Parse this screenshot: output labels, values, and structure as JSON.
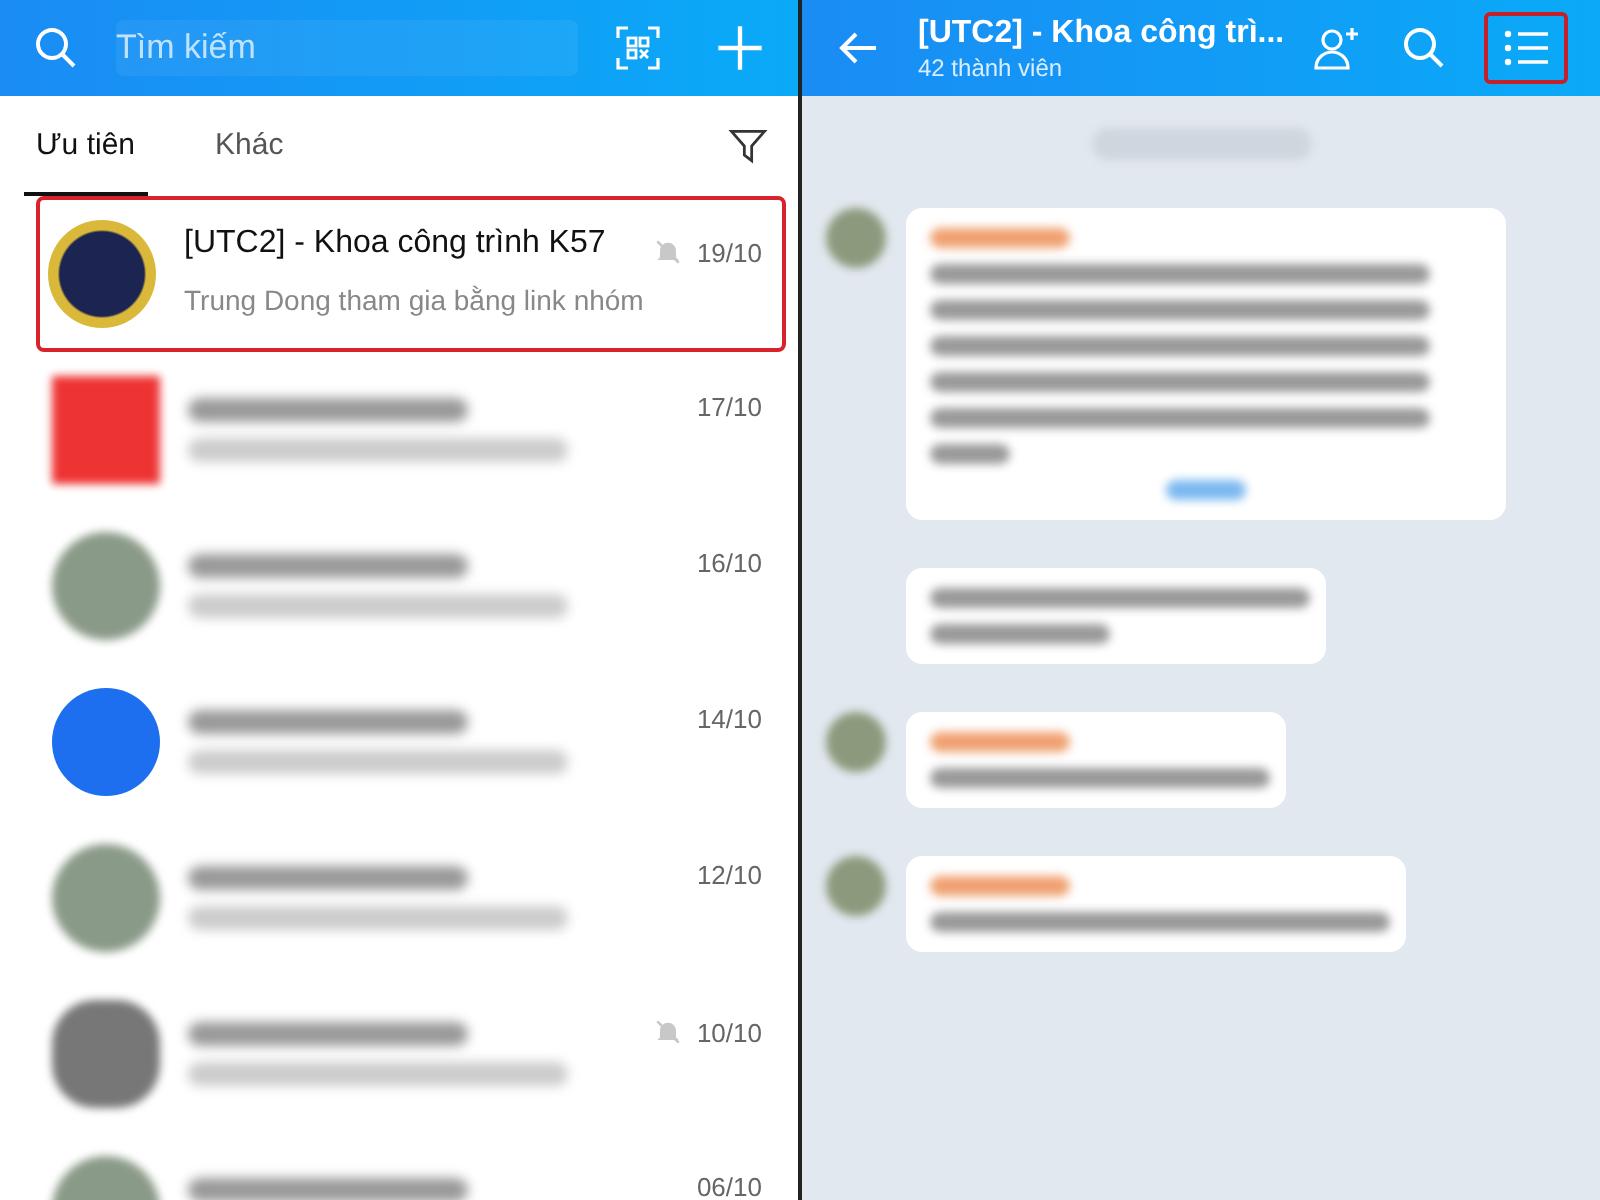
{
  "chat_list": {
    "search": {
      "placeholder": "Tìm kiếm"
    },
    "tabs": [
      {
        "label": "Ưu tiên",
        "selected": true
      },
      {
        "label": "Khác",
        "selected": false
      }
    ],
    "chats": [
      {
        "kind": "logo",
        "title": "[UTC2] - Khoa công trình K57",
        "preview": "Trung Dong tham gia bằng link nhóm",
        "date": "19/10",
        "muted": true,
        "highlighted": true
      },
      {
        "kind": "brand",
        "date": "17/10",
        "muted": false,
        "highlighted": false
      },
      {
        "kind": "photo",
        "date": "16/10",
        "muted": false,
        "highlighted": false
      },
      {
        "kind": "initials",
        "date": "14/10",
        "muted": false,
        "highlighted": false
      },
      {
        "kind": "photo",
        "date": "12/10",
        "muted": false,
        "highlighted": false
      },
      {
        "kind": "group",
        "date": "10/10",
        "muted": true,
        "highlighted": false
      },
      {
        "kind": "photo",
        "date": "06/10",
        "muted": false,
        "highlighted": false
      }
    ]
  },
  "conversation": {
    "title": "[UTC2] - Khoa công trì...",
    "subtitle": "42 thành viên",
    "menu_highlighted": true
  }
}
